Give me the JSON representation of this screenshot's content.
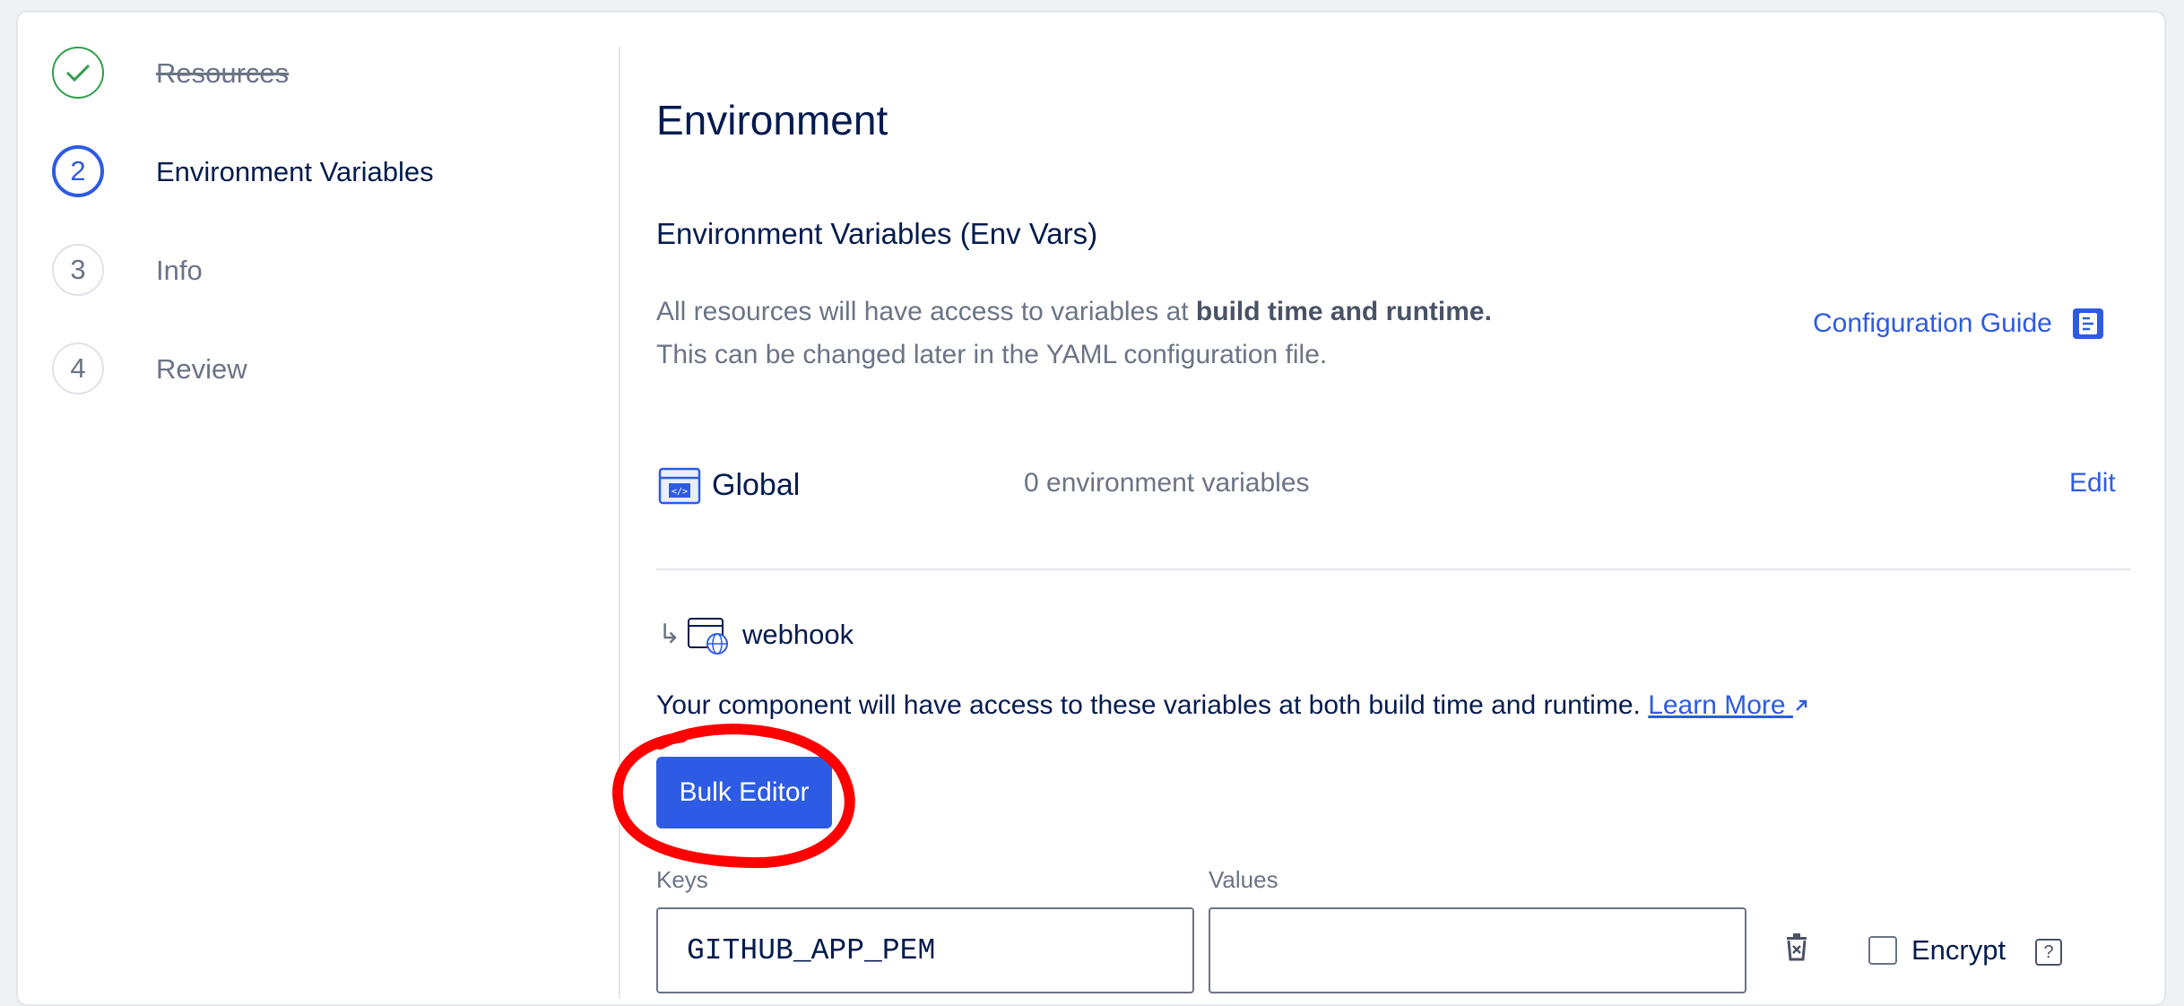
{
  "steps": [
    {
      "number": "✓",
      "label": "Resources",
      "state": "done"
    },
    {
      "number": "2",
      "label": "Environment Variables",
      "state": "active"
    },
    {
      "number": "3",
      "label": "Info",
      "state": "idle"
    },
    {
      "number": "4",
      "label": "Review",
      "state": "idle"
    }
  ],
  "page": {
    "title": "Environment",
    "section_title": "Environment Variables (Env Vars)",
    "desc_line1_prefix": "All resources will have access to variables at ",
    "desc_line1_bold": "build time and runtime.",
    "desc_line2": "This can be changed later in the YAML configuration file.",
    "config_guide_label": "Configuration Guide"
  },
  "global": {
    "label": "Global",
    "count_text": "0 environment variables",
    "edit_label": "Edit"
  },
  "component": {
    "arrow": "↳",
    "name": "webhook",
    "desc": "Your component will have access to these variables at both build time and runtime. ",
    "learn_more": "Learn More",
    "bulk_editor_label": "Bulk Editor"
  },
  "env_table": {
    "keys_header": "Keys",
    "values_header": "Values",
    "rows": [
      {
        "key": "GITHUB_APP_PEM",
        "value": "",
        "encrypt": false
      }
    ],
    "encrypt_label": "Encrypt",
    "help_label": "?"
  },
  "colors": {
    "accent": "#2d5be3",
    "success": "#2f9e4b",
    "annotation": "#ff0000",
    "text_dark": "#031b4e",
    "text_muted": "#6b7385"
  }
}
